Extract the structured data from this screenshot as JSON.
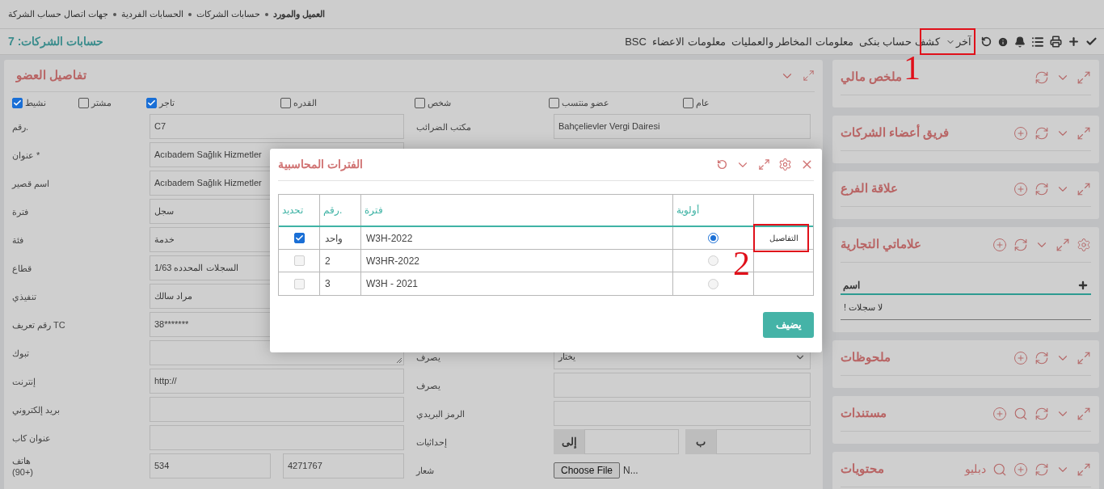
{
  "breadcrumb": [
    {
      "label": "العميل والمورد",
      "current": true
    },
    {
      "label": "حسابات الشركات",
      "current": false
    },
    {
      "label": "الحسابات الفردية",
      "current": false
    },
    {
      "label": "جهات اتصال حساب الشركة",
      "current": false
    }
  ],
  "page_title": "حسابات الشركات: 7",
  "toolbar_menu": [
    {
      "label": "آخر",
      "kind": "dropdown"
    },
    {
      "label": "كشف حساب بنكى",
      "kind": "link"
    },
    {
      "label": "معلومات المخاطر والعمليات",
      "kind": "link"
    },
    {
      "label": "معلومات الاعضاء",
      "kind": "link"
    },
    {
      "label": "BSC",
      "kind": "link"
    }
  ],
  "member_panel": {
    "title": "تفاصيل العضو",
    "flags": [
      {
        "label": "عام",
        "checked": false
      },
      {
        "label": "عضو منتسب",
        "checked": false
      },
      {
        "label": "شخص",
        "checked": false
      },
      {
        "label": "القدره",
        "checked": false
      },
      {
        "label": "تاجر",
        "checked": true
      },
      {
        "label": "مشتر",
        "checked": false
      },
      {
        "label": "نشيط",
        "checked": true
      }
    ],
    "left_fields": [
      {
        "label": "رقم.",
        "kind": "text",
        "value": "C7"
      },
      {
        "label": "عنوان *",
        "kind": "text",
        "value": "Acıbadem Sağlık Hizmetler"
      },
      {
        "label": "اسم قصير",
        "kind": "text",
        "value": "Acıbadem Sağlık Hizmetler"
      },
      {
        "label": "فترة",
        "kind": "text",
        "value": "سجل"
      },
      {
        "label": "فئة",
        "kind": "text",
        "value": "خدمة"
      },
      {
        "label": "قطاع",
        "kind": "text",
        "value": "السجلات المحدده 1/63"
      },
      {
        "label": "تنفيذي",
        "kind": "text",
        "value": "مراد سالك"
      },
      {
        "label": "رقم تعريف TC",
        "kind": "text",
        "value": "38*******"
      },
      {
        "label": "تبوك",
        "kind": "textarea"
      },
      {
        "label": "إنترنت",
        "kind": "text",
        "value": "http://"
      },
      {
        "label": "بريد إلكتروني",
        "kind": "text"
      },
      {
        "label": "عنوان كاب",
        "kind": "text"
      },
      {
        "label": "هاتف (+90)",
        "kind": "pair",
        "values": [
          "4271767",
          "534"
        ]
      }
    ],
    "right_fields": [
      {
        "label": "مكتب الضرائب",
        "kind": "text",
        "value": "Bahçelievler Vergi Dairesi"
      },
      {
        "kind": "hidden"
      },
      {
        "label": "يصرف",
        "kind": "select",
        "value": "يختار"
      },
      {
        "label": "يصرف",
        "kind": "text"
      },
      {
        "label": "الرمز البريدي",
        "kind": "text"
      },
      {
        "label": "إحداثيات",
        "kind": "coords",
        "addons": [
          "ب",
          "إلى"
        ]
      },
      {
        "label": "شعار",
        "kind": "file",
        "button": "Choose File",
        "status": "N..."
      }
    ]
  },
  "side_panels": [
    {
      "title": "ملخص مالي",
      "kind": "summary"
    },
    {
      "title": "فريق أعضاء الشركات",
      "kind": "list"
    },
    {
      "title": "علاقة الفرع",
      "kind": "list"
    },
    {
      "title": "علاماتي التجارية",
      "kind": "table",
      "table": {
        "column": "اسم",
        "empty": "! لا سجلات"
      }
    },
    {
      "title": "ملحوظات",
      "kind": "list"
    },
    {
      "title": "مستندات",
      "kind": "documents"
    },
    {
      "title": "محتويات",
      "kind": "contents",
      "filter_label": "دبليو"
    }
  ],
  "modal": {
    "title": "الفترات المحاسبية",
    "columns": [
      "أولوية",
      "فترة",
      "رقم.",
      "تحديد"
    ],
    "rows": [
      {
        "checked": true,
        "number": "واحد",
        "period": "W3H-2022",
        "selected": true,
        "details": "التفاصيل"
      },
      {
        "checked": false,
        "number": "2",
        "period": "W3HR-2022",
        "selected": false
      },
      {
        "checked": false,
        "number": "3",
        "period": "W3H - 2021",
        "selected": false
      }
    ],
    "button": "يضيف"
  },
  "annotations": [
    {
      "label": "1"
    },
    {
      "label": "2"
    }
  ]
}
